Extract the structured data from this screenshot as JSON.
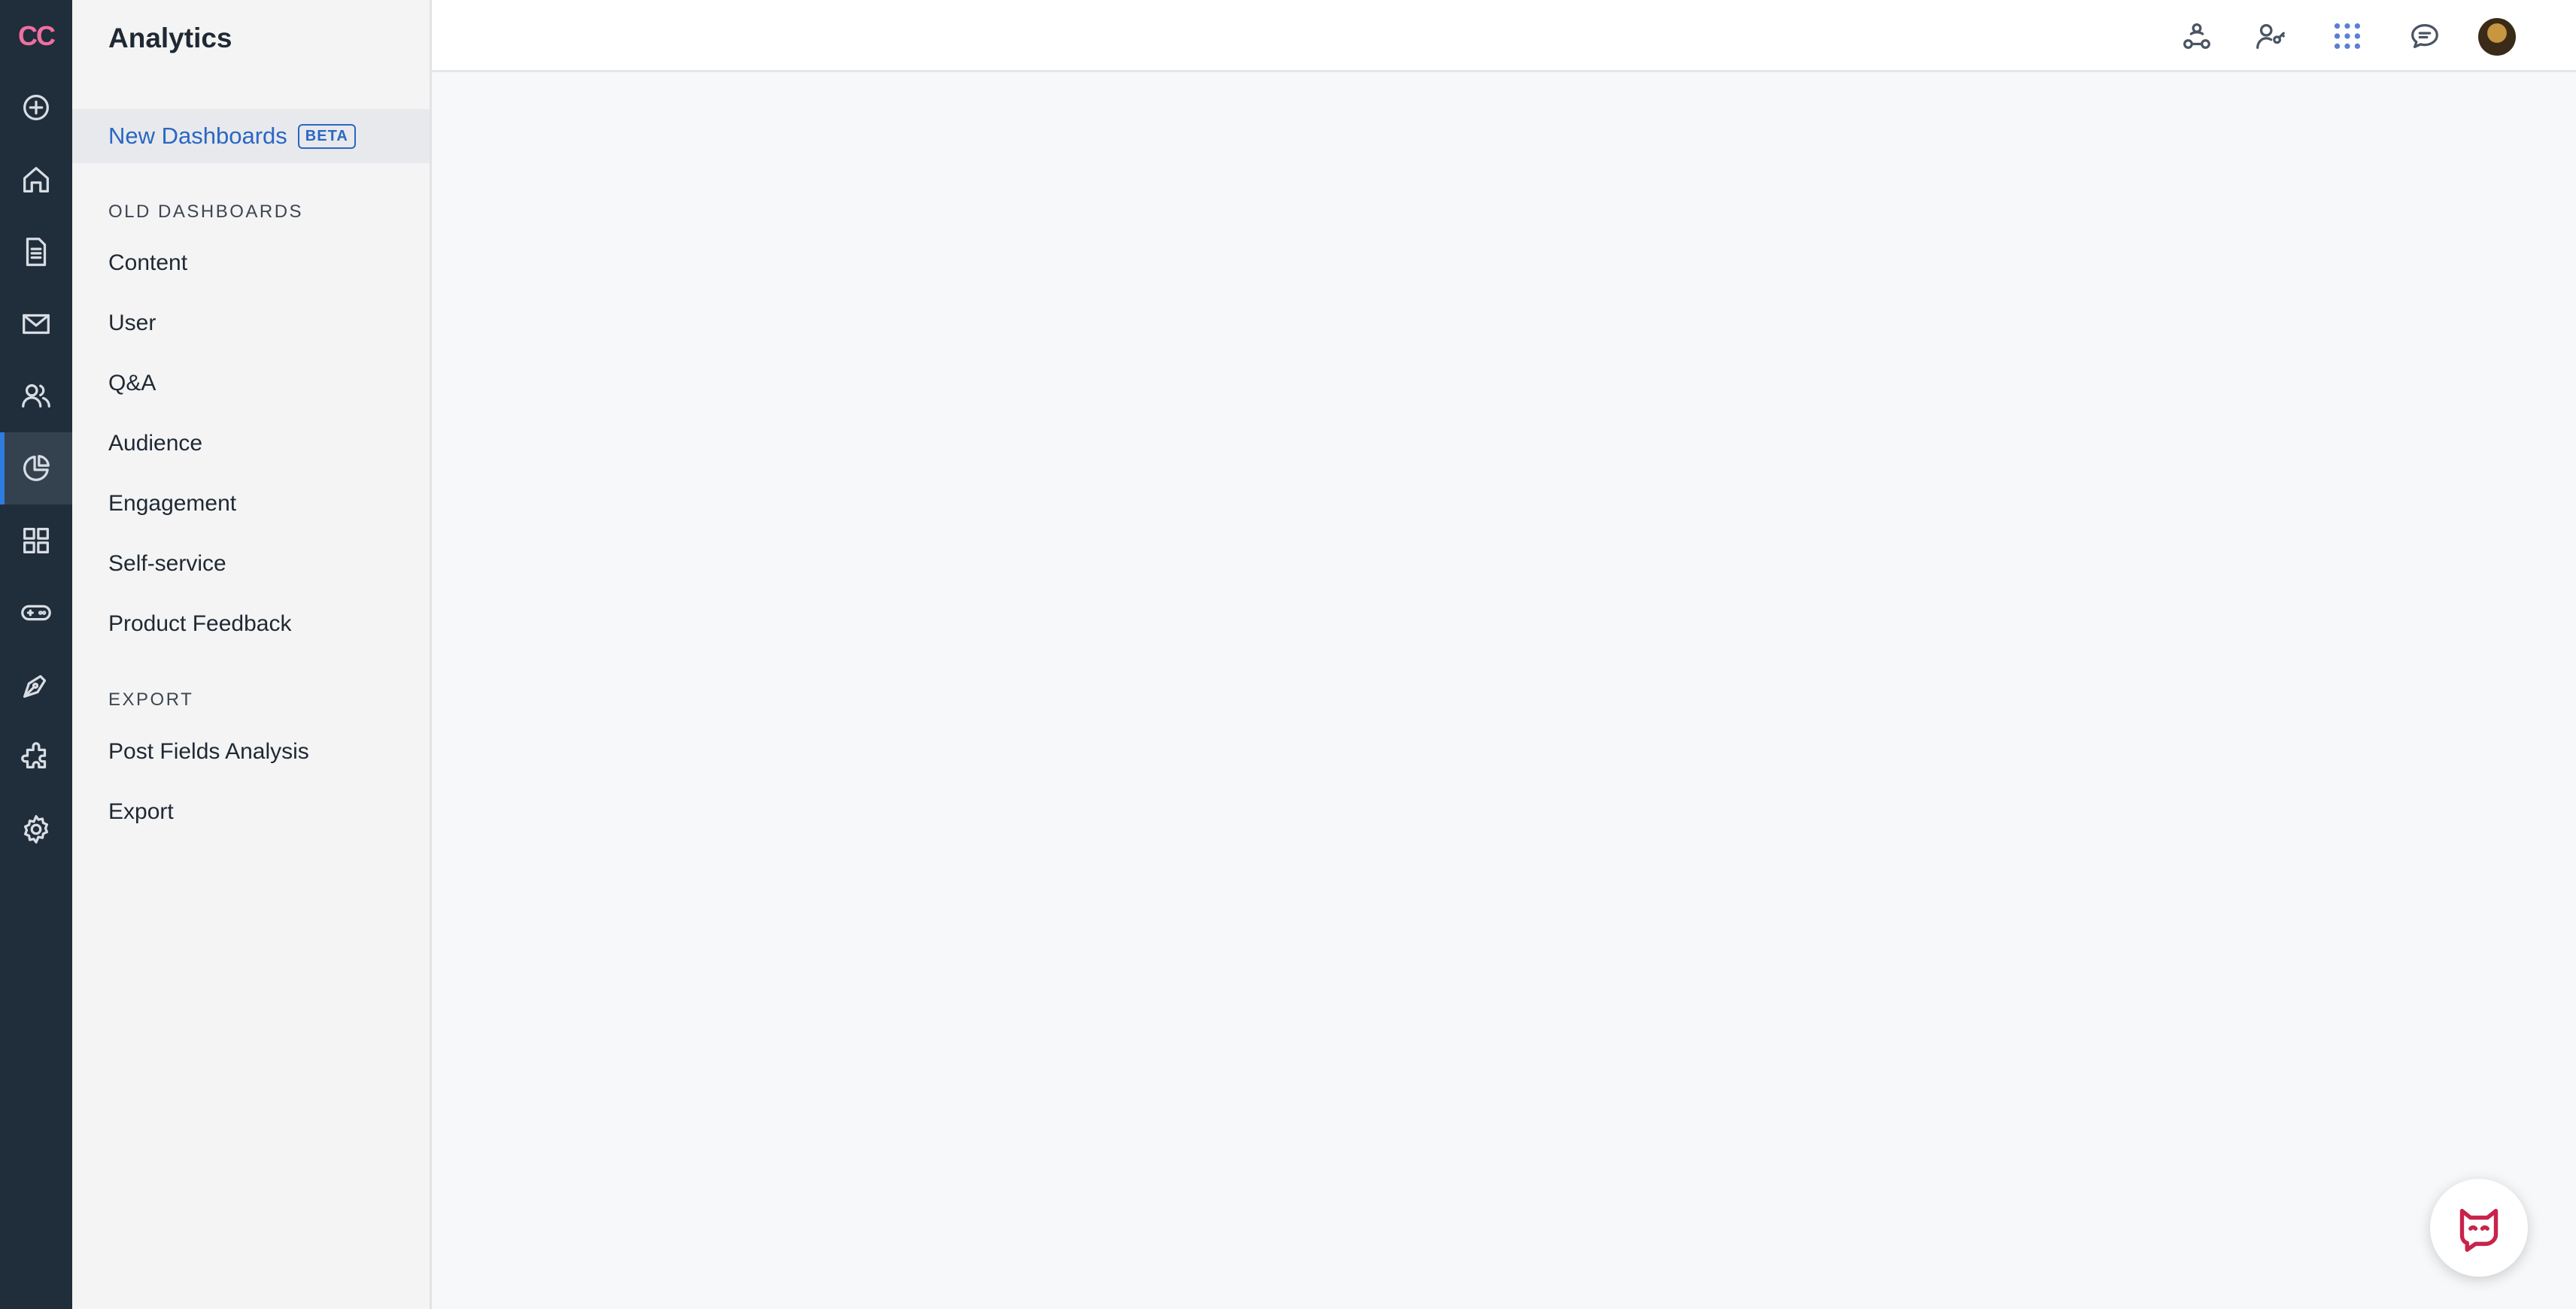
{
  "rail": {
    "logo": "CC",
    "items": [
      {
        "icon": "plus-circle-icon"
      },
      {
        "icon": "home-icon"
      },
      {
        "icon": "document-icon"
      },
      {
        "icon": "mail-icon"
      },
      {
        "icon": "users-icon"
      },
      {
        "icon": "analytics-pie-icon",
        "active": true
      },
      {
        "icon": "apps-grid-icon"
      },
      {
        "icon": "gamepad-icon"
      },
      {
        "icon": "pen-icon"
      },
      {
        "icon": "puzzle-icon"
      },
      {
        "icon": "settings-gear-icon"
      }
    ]
  },
  "sidebar": {
    "title": "Analytics",
    "active_item": {
      "label": "New Dashboards",
      "badge": "BETA"
    },
    "old_section": {
      "heading": "OLD DASHBOARDS",
      "items": [
        "Content",
        "User",
        "Q&A",
        "Audience",
        "Engagement",
        "Self-service",
        "Product Feedback"
      ]
    },
    "export_section": {
      "heading": "EXPORT",
      "items": [
        "Post Fields Analysis",
        "Export"
      ]
    }
  },
  "header": {
    "icons": [
      "community-icon",
      "user-key-icon",
      "apps-dots-icon",
      "chat-icon",
      "avatar"
    ]
  },
  "colors": {
    "rail_bg": "#202d3b",
    "accent": "#2f7ce0",
    "logo": "#f06fa0",
    "active_link": "#2a67c4",
    "bot": "#c8234b"
  }
}
